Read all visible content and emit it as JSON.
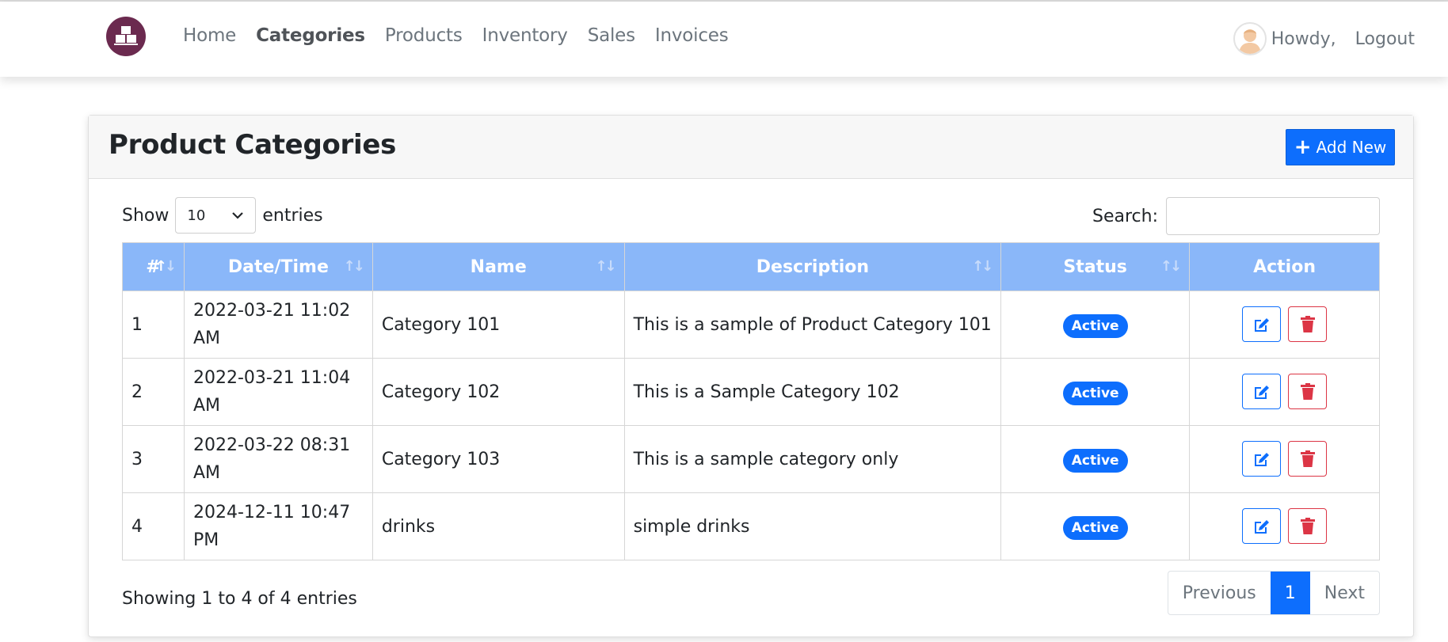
{
  "nav": {
    "links": [
      "Home",
      "Categories",
      "Products",
      "Inventory",
      "Sales",
      "Invoices"
    ],
    "active": "Categories",
    "howdy": "Howdy,",
    "logout": "Logout"
  },
  "page": {
    "title": "Product Categories",
    "add_button": "Add New"
  },
  "table_controls": {
    "show_label": "Show",
    "page_length": "10",
    "entries_label": "entries",
    "search_label": "Search:",
    "search_value": ""
  },
  "table": {
    "columns": [
      "#",
      "Date/Time",
      "Name",
      "Description",
      "Status",
      "Action"
    ],
    "rows": [
      {
        "num": "1",
        "datetime": "2022-03-21 11:02 AM",
        "name": "Category 101",
        "description": "This is a sample of Product Category 101",
        "status": "Active"
      },
      {
        "num": "2",
        "datetime": "2022-03-21 11:04 AM",
        "name": "Category 102",
        "description": "This is a Sample Category 102",
        "status": "Active"
      },
      {
        "num": "3",
        "datetime": "2022-03-22 08:31 AM",
        "name": "Category 103",
        "description": "This is a sample category only",
        "status": "Active"
      },
      {
        "num": "4",
        "datetime": "2024-12-11 10:47 PM",
        "name": "drinks",
        "description": "simple drinks",
        "status": "Active"
      }
    ]
  },
  "footer": {
    "info": "Showing 1 to 4 of 4 entries",
    "previous": "Previous",
    "current_page": "1",
    "next": "Next"
  },
  "colors": {
    "primary": "#0d6efd",
    "danger": "#dc3545",
    "header_bg": "#8ab7f9",
    "brand": "#6b2a4f"
  },
  "icons": [
    "logo-icon",
    "user-avatar-icon",
    "plus-icon",
    "chevron-down-icon",
    "sort-icon",
    "edit-icon",
    "trash-icon"
  ]
}
